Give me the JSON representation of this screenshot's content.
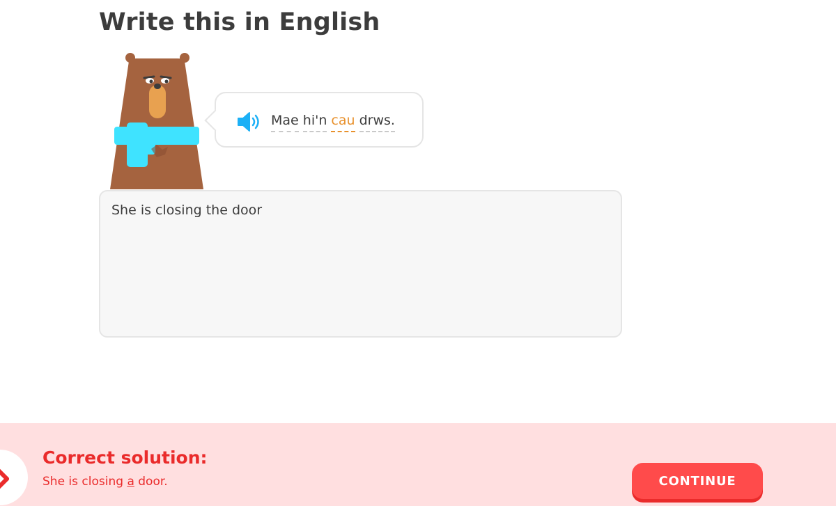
{
  "header": {
    "title": "Write this in English"
  },
  "prompt": {
    "speaker_icon": "speaker-icon",
    "words": [
      {
        "text": "Mae",
        "new": false
      },
      {
        "text": "hi'n",
        "new": false
      },
      {
        "text": "cau",
        "new": true
      },
      {
        "text": "drws.",
        "new": false
      }
    ]
  },
  "answer": {
    "value": "She is closing the door"
  },
  "feedback": {
    "status_icon": "close-icon",
    "heading": "Correct solution:",
    "solution_before": "She is closing ",
    "solution_highlight": "a",
    "solution_after": " door.",
    "continue_label": "CONTINUE"
  },
  "colors": {
    "error": "#ea2b2b",
    "error_bg": "#ffdfe0",
    "button": "#ff4b4b",
    "new_word": "#e8912d",
    "speaker": "#1cb0f6",
    "bear": "#a5633f",
    "scarf": "#3fe3ff"
  }
}
